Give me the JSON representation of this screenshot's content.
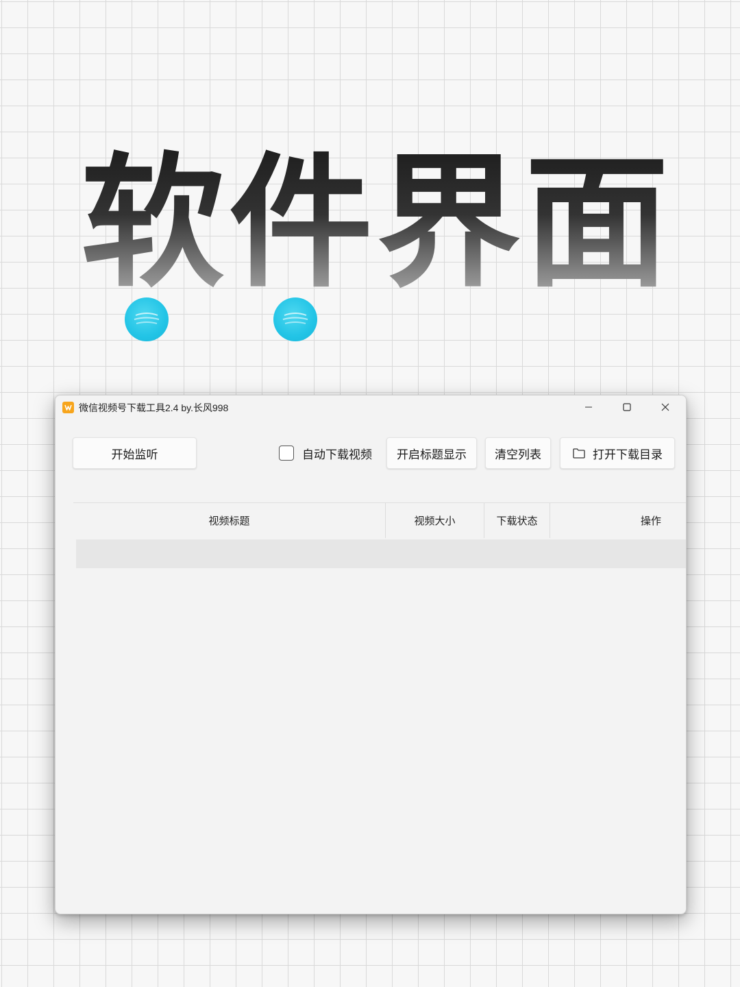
{
  "hero": {
    "title": "软件界面"
  },
  "window": {
    "title": "微信视频号下载工具2.4 by.长风998",
    "app_icon": "app-logo-icon",
    "controls": {
      "minimize_icon": "minimize-icon",
      "maximize_icon": "maximize-icon",
      "close_icon": "close-icon"
    }
  },
  "toolbar": {
    "start_label": "开始监听",
    "auto_download_label": "自动下载视频",
    "auto_download_checked": false,
    "title_display_label": "开启标题显示",
    "clear_label": "清空列表",
    "open_dir_label": "打开下载目录",
    "open_dir_icon": "folder-icon"
  },
  "table": {
    "columns": [
      "视频标题",
      "视频大小",
      "下载状态",
      "操作"
    ],
    "rows": []
  },
  "colors": {
    "dot_accent": "#22c4e6",
    "app_icon": "#f7a51c"
  }
}
